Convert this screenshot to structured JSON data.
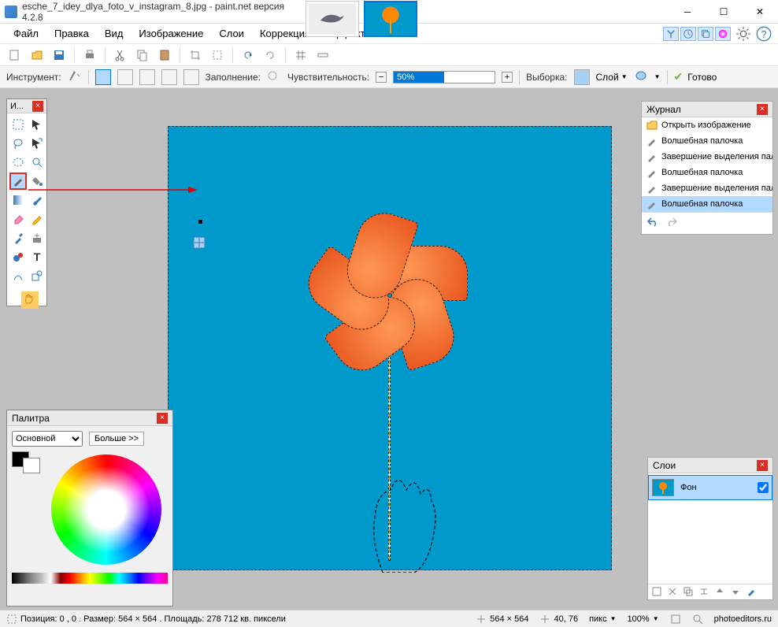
{
  "titlebar": {
    "title": "esche_7_idey_dlya_foto_v_instagram_8.jpg - paint.net версия 4.2.8"
  },
  "menu": {
    "file": "Файл",
    "edit": "Правка",
    "view": "Вид",
    "image": "Изображение",
    "layers": "Слои",
    "adjust": "Коррекция",
    "effects": "Эффекты"
  },
  "tooloptions": {
    "instrument": "Инструмент:",
    "fill": "Заполнение:",
    "tolerance": "Чувствительность:",
    "tolerance_value": "50%",
    "sampling": "Выборка:",
    "sampling_value": "Слой",
    "finish": "Готово"
  },
  "toolspanel": {
    "title": "И..."
  },
  "history": {
    "title": "Журнал",
    "items": [
      "Открыть изображение",
      "Волшебная палочка",
      "Завершение выделения палочкой",
      "Волшебная палочка",
      "Завершение выделения палочкой",
      "Волшебная палочка"
    ]
  },
  "palette": {
    "title": "Палитра",
    "primary": "Основной",
    "more": "Больше >>"
  },
  "layers": {
    "title": "Слои",
    "bg": "Фон"
  },
  "status": {
    "pos": "Позиция: 0 , 0 . Размер: 564  × 564 . Площадь: 278 712 кв. пиксели",
    "dims": "564 × 564",
    "cursor": "40, 76",
    "units": "пикс",
    "zoom": "100%",
    "site": "photoeditors.ru"
  }
}
